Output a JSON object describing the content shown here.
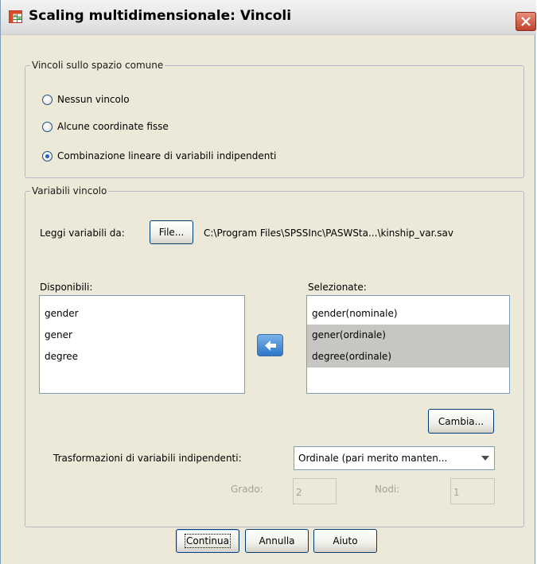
{
  "window": {
    "title": "Scaling multidimensionale: Vincoli"
  },
  "common_space": {
    "legend": "Vincoli sullo spazio comune",
    "options": [
      {
        "label": "Nessun vincolo",
        "selected": false
      },
      {
        "label": "Alcune coordinate fisse",
        "selected": false
      },
      {
        "label": "Combinazione lineare di variabili indipendenti",
        "selected": true
      }
    ]
  },
  "constraint_vars": {
    "legend": "Variabili vincolo",
    "read_label": "Leggi variabili da:",
    "file_button": "File...",
    "file_path": "C:\\Program Files\\SPSSInc\\PASWSta...\\kinship_var.sav",
    "available_label": "Disponibili:",
    "available_items": [
      "gender",
      "gener",
      "degree"
    ],
    "selected_label": "Selezionate:",
    "selected_items": [
      {
        "label": "gender(nominale)",
        "highlighted": false
      },
      {
        "label": "gener(ordinale)",
        "highlighted": true
      },
      {
        "label": "degree(ordinale)",
        "highlighted": true
      }
    ],
    "change_button": "Cambia...",
    "transform_label": "Trasformazioni di variabili indipendenti:",
    "transform_value": "Ordinale (pari merito manten...",
    "degree_label": "Grado:",
    "degree_value": "2",
    "knots_label": "Nodi:",
    "knots_value": "1"
  },
  "footer": {
    "continue_button": "Continua",
    "cancel_button": "Annulla",
    "help_button": "Aiuto"
  },
  "colors": {
    "dialog_bg": "#ece9d8",
    "selected_row": "#c8c6c2",
    "accent_blue": "#2f76c8",
    "close_red": "#c0412b"
  },
  "icons": [
    "table-app-icon",
    "close-x-icon",
    "arrow-left-icon"
  ]
}
